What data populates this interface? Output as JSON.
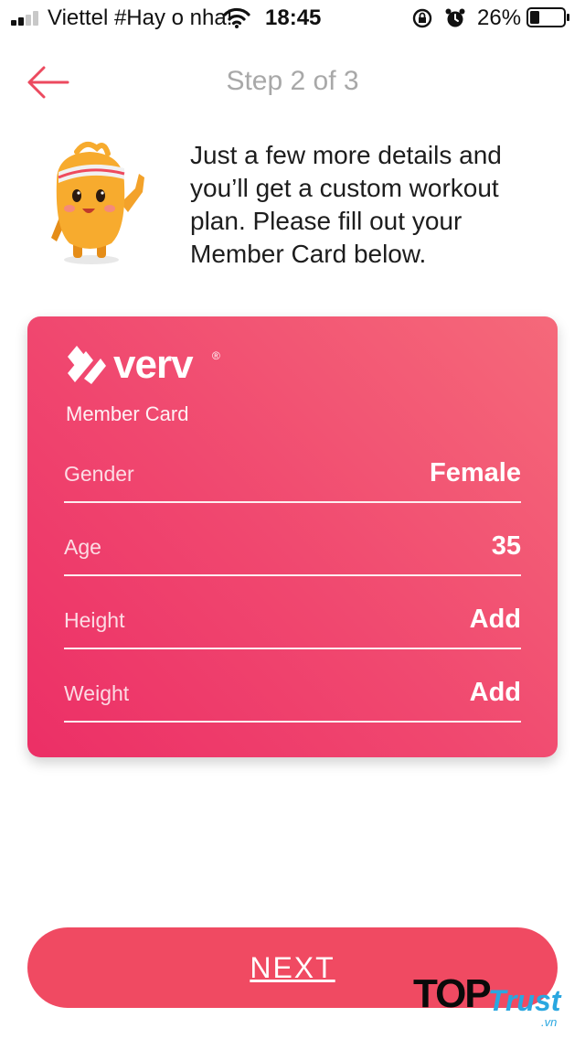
{
  "status_bar": {
    "carrier": "Viettel #Hay o nha!",
    "time": "18:45",
    "battery_percent": "26%",
    "signal_bars_active": 2,
    "signal_bars_total": 4,
    "icons": [
      "signal-icon",
      "wifi-icon",
      "rotation-lock-icon",
      "alarm-icon",
      "battery-icon"
    ]
  },
  "header": {
    "back_icon": "arrow-left-icon",
    "step_label": "Step 2 of 3"
  },
  "intro": {
    "mascot": "mascot-character",
    "text": "Just a few more details and you’ll get a custom workout plan. Please fill out your Member Card below."
  },
  "card": {
    "brand": "verv",
    "brand_mark": "®",
    "subtitle": "Member Card",
    "fields": [
      {
        "label": "Gender",
        "value": "Female"
      },
      {
        "label": "Age",
        "value": "35"
      },
      {
        "label": "Height",
        "value": "Add"
      },
      {
        "label": "Weight",
        "value": "Add"
      }
    ]
  },
  "footer": {
    "next_label": "NEXT"
  },
  "watermark": {
    "part1": "TOP",
    "part2": "Trust",
    "part3": ".vn"
  },
  "colors": {
    "accent": "#f04a62",
    "card_gradient_start": "#f5697a",
    "card_gradient_end": "#ec2f66",
    "step_text": "#a8a8a8",
    "watermark_blue": "#2aa7e0"
  }
}
